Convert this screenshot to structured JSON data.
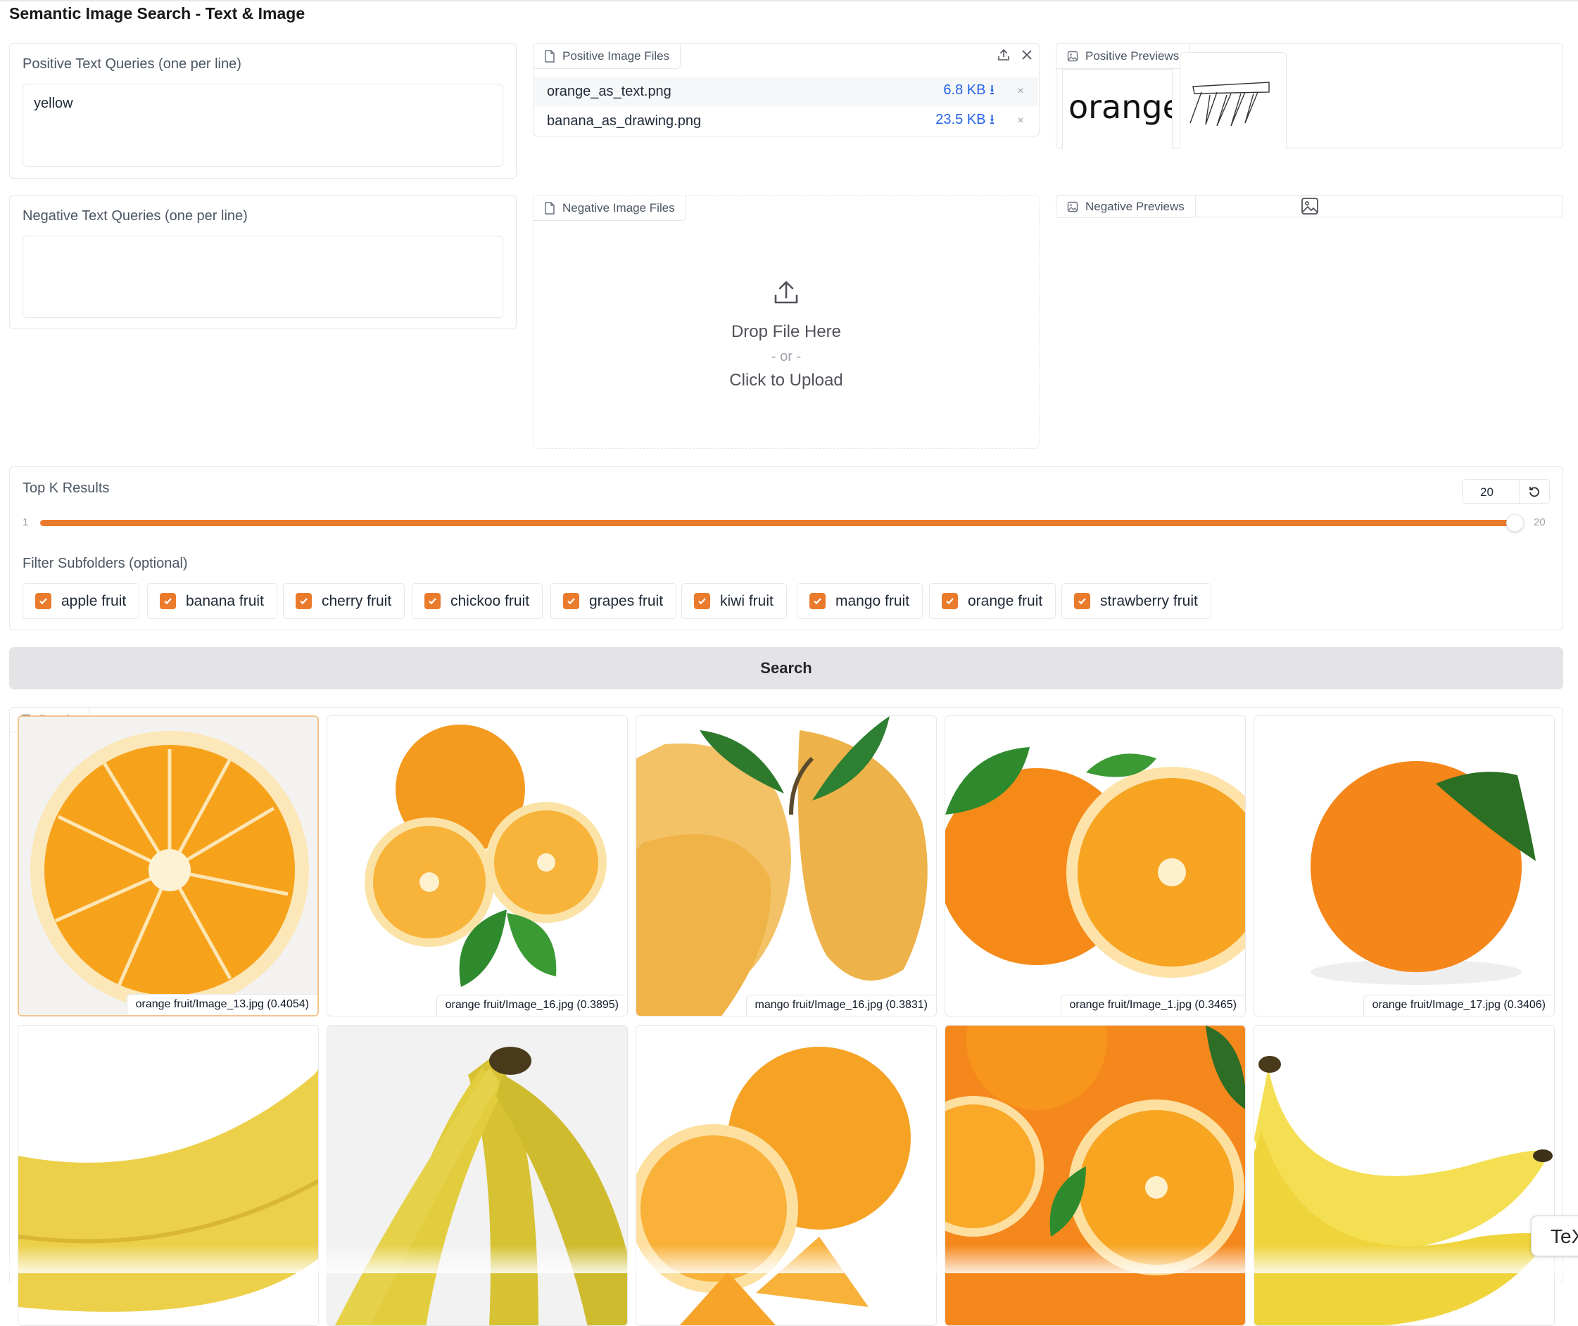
{
  "app": {
    "title": "Semantic Image Search - Text & Image"
  },
  "positive_text": {
    "label": "Positive Text Queries (one per line)",
    "value": "yellow"
  },
  "negative_text": {
    "label": "Negative Text Queries (one per line)",
    "value": ""
  },
  "positive_files": {
    "label": "Positive Image Files",
    "files": [
      {
        "name": "orange_as_text.png",
        "size": "6.8 KB ⭳"
      },
      {
        "name": "banana_as_drawing.png",
        "size": "23.5 KB ⭳"
      }
    ],
    "remove_glyph": "×"
  },
  "positive_previews": {
    "label": "Positive Previews",
    "thumb_text": "orange"
  },
  "negative_files": {
    "label": "Negative Image Files",
    "drop_title": "Drop File Here",
    "drop_or": "- or -",
    "drop_click": "Click to Upload"
  },
  "negative_previews": {
    "label": "Negative Previews"
  },
  "top_k": {
    "label": "Top K Results",
    "value": "20",
    "min": "1",
    "max": "20",
    "fraction": 1.0
  },
  "filter": {
    "label": "Filter Subfolders (optional)",
    "options": [
      {
        "label": "apple fruit",
        "checked": true
      },
      {
        "label": "banana fruit",
        "checked": true
      },
      {
        "label": "cherry fruit",
        "checked": true
      },
      {
        "label": "chickoo fruit",
        "checked": true
      },
      {
        "label": "grapes fruit",
        "checked": true
      },
      {
        "label": "kiwi fruit",
        "checked": true
      },
      {
        "label": "mango fruit",
        "checked": true
      },
      {
        "label": "orange fruit",
        "checked": true
      },
      {
        "label": "strawberry fruit",
        "checked": true
      }
    ]
  },
  "search_button": "Search",
  "results": {
    "label": "Results",
    "items": [
      {
        "caption": "orange fruit/Image_13.jpg (0.4054)",
        "kind": "orange-half-icon"
      },
      {
        "caption": "orange fruit/Image_16.jpg (0.3895)",
        "kind": "orange-halves-icon"
      },
      {
        "caption": "mango fruit/Image_16.jpg (0.3831)",
        "kind": "mango-icon"
      },
      {
        "caption": "orange fruit/Image_1.jpg (0.3465)",
        "kind": "orange-with-half-icon"
      },
      {
        "caption": "orange fruit/Image_17.jpg (0.3406)",
        "kind": "orange-whole-icon"
      },
      {
        "caption": "",
        "kind": "banana-closeup-icon"
      },
      {
        "caption": "",
        "kind": "banana-bunch-icon"
      },
      {
        "caption": "",
        "kind": "orange-slices-icon"
      },
      {
        "caption": "",
        "kind": "orange-pile-icon"
      },
      {
        "caption": "",
        "kind": "banana-bunch-icon"
      }
    ]
  },
  "floating_tab": {
    "label": "TeX"
  },
  "colors": {
    "accent": "#ea7b2c",
    "link": "#2563eb",
    "border": "#e5e7eb",
    "button_bg": "#e4e4e7",
    "orange": "#f7a21b",
    "banana": "#f0d34a"
  }
}
